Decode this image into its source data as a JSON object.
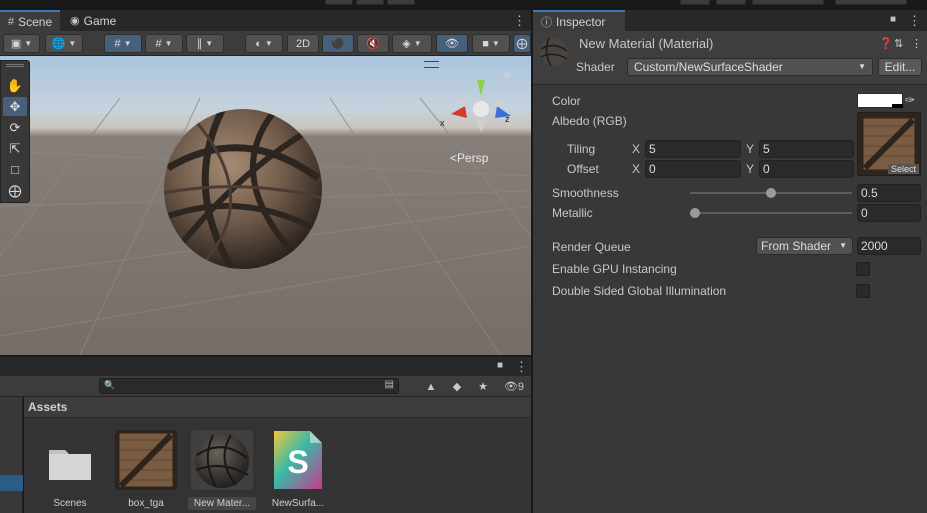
{
  "scene_panel": {
    "tabs": [
      {
        "label": "Scene",
        "icon": "grid-icon",
        "active": true
      },
      {
        "label": "Game",
        "icon": "gamepad-icon",
        "active": false
      }
    ],
    "toolbar": {
      "mode_2d_label": "2D"
    },
    "viewport": {
      "persp_label": "Persp",
      "axis_x": "x",
      "axis_z": "z"
    }
  },
  "project_panel": {
    "hidden_count": "9",
    "search_placeholder": "",
    "breadcrumb": "Assets",
    "assets": [
      {
        "name": "Scenes",
        "kind": "folder"
      },
      {
        "name": "box_tga",
        "kind": "texture"
      },
      {
        "name": "New Mater...",
        "kind": "material",
        "selected": true
      },
      {
        "name": "NewSurfa...",
        "kind": "shader"
      }
    ]
  },
  "inspector": {
    "tab_label": "Inspector",
    "material_title": "New Material (Material)",
    "shader_label": "Shader",
    "shader_value": "Custom/NewSurfaceShader",
    "edit_label": "Edit...",
    "properties": {
      "color_label": "Color",
      "color_value": "#ffffff",
      "albedo_label": "Albedo (RGB)",
      "select_label": "Select",
      "tiling_label": "Tiling",
      "offset_label": "Offset",
      "x_label": "X",
      "y_label": "Y",
      "tiling_x": "5",
      "tiling_y": "5",
      "offset_x": "0",
      "offset_y": "0",
      "smoothness_label": "Smoothness",
      "smoothness_value": "0.5",
      "smoothness_fraction": 0.5,
      "metallic_label": "Metallic",
      "metallic_value": "0",
      "metallic_fraction": 0,
      "render_queue_label": "Render Queue",
      "render_queue_source": "From Shader",
      "render_queue_value": "2000",
      "gpu_instancing_label": "Enable GPU Instancing",
      "gpu_instancing_checked": false,
      "double_sided_gi_label": "Double Sided Global Illumination",
      "double_sided_gi_checked": false
    }
  },
  "colors": {
    "accent": "#3a79bb",
    "panel_bg": "#383838",
    "selection": "#2c5d87"
  }
}
